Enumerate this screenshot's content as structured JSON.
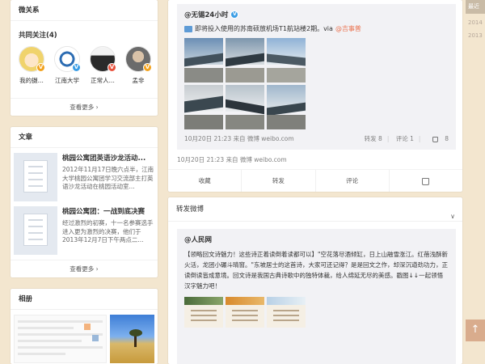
{
  "friends_card": {
    "title": "微关系",
    "follow_label": "共同关注(4)",
    "more_label": "查看更多 ›",
    "items": [
      {
        "name": "我的摄...",
        "badge": "V"
      },
      {
        "name": "江南大学",
        "badge": "V"
      },
      {
        "name": "正常人...",
        "badge": "V"
      },
      {
        "name": "孟非",
        "badge": "V"
      }
    ]
  },
  "articles_card": {
    "title": "文章",
    "more_label": "查看更多 ›",
    "items": [
      {
        "title": "桃园公寓团英语沙龙活动...",
        "text": "2012年11月17日晚六点半，江南大学桃园公寓团学习交流部主打英语沙龙活动在桃园活动室..."
      },
      {
        "title": "桃园公寓团：一战到底决赛",
        "text": "经过激烈的初赛，十一名参赛选手进入更为激烈的决赛，他们于2013年12月7日下午两点二..."
      }
    ]
  },
  "photos_card": {
    "title": "相册"
  },
  "weibo_card": {
    "author": "@无锡24小时",
    "badge": "V",
    "text": "即将投入使用的苏南硕放机场T1航站楼2期。via",
    "mention": "@吉事普",
    "quote_time": "10月20日 21:23 来自 微博 weibo.com",
    "quote_actions": {
      "repost": "转发 8",
      "comment": "评论 1",
      "like": "8"
    },
    "post_meta": "10月20日 21:23 来自 微博 weibo.com",
    "actions": {
      "fav": "收藏",
      "repost": "转发",
      "comment": "评论"
    }
  },
  "repost_card": {
    "title": "转发微博",
    "author": "@人民网",
    "text_tag": "【领略回文诗魅力！这些诗正着读倒着读都可以】",
    "text_body": "\"空花落尽酒倾缸，日上山融雪涨江。红蓓浅酥新火活，龙团小碾斗晴窗。\"东坡居士的这首诗，大家可还记得？是是回文之作，却深沉遒劲功力，正读倒读皆成意境。回文诗是我国古典诗歌中的独特体裁，给人绵延无尽的美感。戳图↓↓一起领悟汉字魅力吧！"
  },
  "right_rail": {
    "latest_label": "最近",
    "years": [
      "2014",
      "2013"
    ],
    "top_icon": "↑"
  }
}
